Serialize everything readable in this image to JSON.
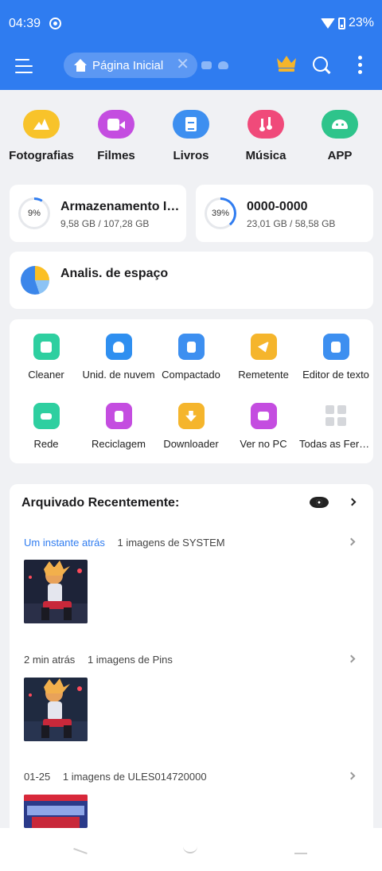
{
  "status_bar": {
    "time": "04:39",
    "battery": "23%"
  },
  "app_bar": {
    "tab_label": "Página Inicial",
    "tab_close": "✕"
  },
  "categories": [
    {
      "label": "Fotografias",
      "color": "#f8c32a"
    },
    {
      "label": "Filmes",
      "color": "#c44de0"
    },
    {
      "label": "Livros",
      "color": "#3d8ff0"
    },
    {
      "label": "Música",
      "color": "#f04a7a"
    },
    {
      "label": "APP",
      "color": "#2ec48b"
    }
  ],
  "storage": [
    {
      "title": "Armazenamento Interno",
      "percent": "9%",
      "usage": "9,58 GB / 107,28 GB",
      "fraction": 0.09
    },
    {
      "title": "0000-0000",
      "percent": "39%",
      "usage": "23,01 GB / 58,58 GB",
      "fraction": 0.39
    }
  ],
  "analysis": {
    "title": "Analis. de espaço"
  },
  "tools": [
    {
      "label": "Cleaner",
      "color": "#2ecfa0"
    },
    {
      "label": "Unid. de nuvem",
      "color": "#2f8ff0"
    },
    {
      "label": "Compactado",
      "color": "#3d8ff0"
    },
    {
      "label": "Remetente",
      "color": "#f5b52c"
    },
    {
      "label": "Editor de texto",
      "color": "#3d8ff0"
    },
    {
      "label": "Rede",
      "color": "#2ecfa0"
    },
    {
      "label": "Reciclagem",
      "color": "#c44de0"
    },
    {
      "label": "Downloader",
      "color": "#f5b52c"
    },
    {
      "label": "Ver no PC",
      "color": "#c44de0"
    },
    {
      "label": "Todas as Ferramentas",
      "color": "#d5d7db"
    }
  ],
  "recent": {
    "title": "Arquivado Recentemente:",
    "groups": [
      {
        "when": "Um instante atrás",
        "desc": "1 imagens de SYSTEM"
      },
      {
        "when": "2 min atrás",
        "desc": "1 imagens de Pins"
      },
      {
        "when": "01-25",
        "desc": "1 imagens de ULES014720000"
      }
    ]
  }
}
